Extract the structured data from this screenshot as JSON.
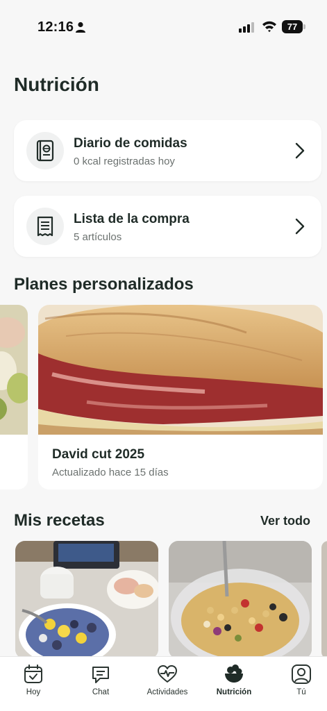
{
  "status_bar": {
    "time": "12:16",
    "battery": "77"
  },
  "page_title": "Nutrición",
  "cards": [
    {
      "title": "Diario de comidas",
      "subtitle": "0 kcal registradas hoy",
      "icon": "food-journal-icon"
    },
    {
      "title": "Lista de la compra",
      "subtitle": "5 artículos",
      "icon": "shopping-list-icon"
    }
  ],
  "plans": {
    "title": "Planes personalizados",
    "items": [
      {
        "title": "David cut 2025",
        "subtitle": "Actualizado hace 15 días"
      }
    ]
  },
  "recipes": {
    "title": "Mis recetas",
    "see_all": "Ver todo"
  },
  "tabbar": {
    "items": [
      {
        "label": "Hoy",
        "icon": "calendar-check-icon"
      },
      {
        "label": "Chat",
        "icon": "chat-icon"
      },
      {
        "label": "Actividades",
        "icon": "heart-pulse-icon"
      },
      {
        "label": "Nutrición",
        "icon": "salad-bowl-icon",
        "active": true
      },
      {
        "label": "Tú",
        "icon": "profile-icon"
      }
    ]
  },
  "colors": {
    "background": "#f7f7f7",
    "card": "#ffffff",
    "text": "#1f2b27",
    "muted": "#6b716f"
  }
}
